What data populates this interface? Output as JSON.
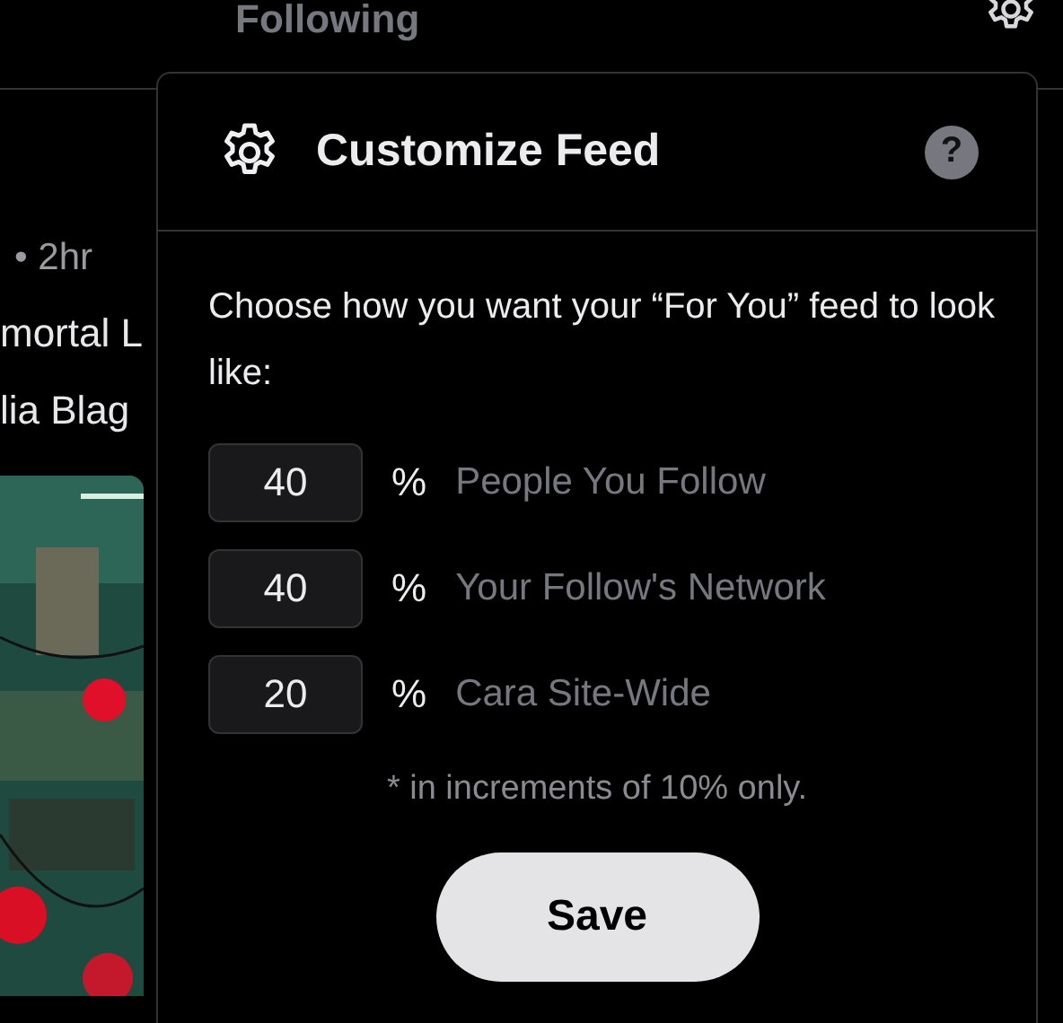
{
  "top_bar": {
    "tab": "Following"
  },
  "post": {
    "meta": "• 2hr",
    "title_fragment": "mortal L",
    "author_fragment": "lia Blag"
  },
  "popup": {
    "title": "Customize Feed",
    "help": "?",
    "description": "Choose how you want your “For You” feed to look like:",
    "rows": [
      {
        "value": "40",
        "unit": "%",
        "label": "People You Follow"
      },
      {
        "value": "40",
        "unit": "%",
        "label": "Your Follow's Network"
      },
      {
        "value": "20",
        "unit": "%",
        "label": "Cara Site-Wide"
      }
    ],
    "note": "* in increments of 10% only.",
    "save": "Save"
  }
}
